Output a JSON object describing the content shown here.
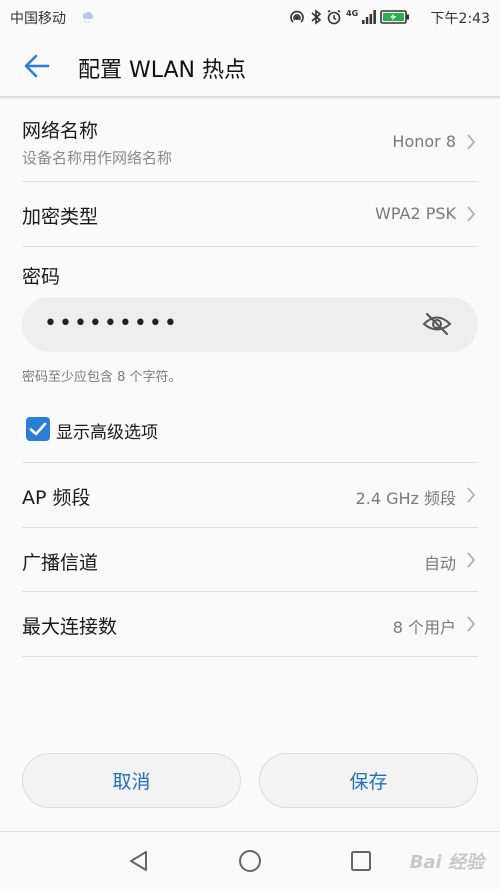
{
  "status_bar": {
    "carrier": "中国移动",
    "network": "4G",
    "time": "下午2:43"
  },
  "header": {
    "title": "配置 WLAN 热点"
  },
  "network_name": {
    "label": "网络名称",
    "sublabel": "设备名称用作网络名称",
    "value": "Honor 8"
  },
  "encryption": {
    "label": "加密类型",
    "value": "WPA2 PSK"
  },
  "password": {
    "label": "密码",
    "masked_value": "•••••••••",
    "hint": "密码至少应包含 8 个字符。"
  },
  "advanced": {
    "label": "显示高级选项",
    "checked": true
  },
  "ap_band": {
    "label": "AP 频段",
    "value": "2.4 GHz 频段"
  },
  "channel": {
    "label": "广播信道",
    "value": "自动"
  },
  "max_connections": {
    "label": "最大连接数",
    "value": "8 个用户"
  },
  "buttons": {
    "cancel": "取消",
    "save": "保存"
  },
  "watermark": "Bai 经验",
  "colors": {
    "accent": "#2a7ed8",
    "button_text": "#1f6fc5",
    "background": "#fafafa"
  }
}
